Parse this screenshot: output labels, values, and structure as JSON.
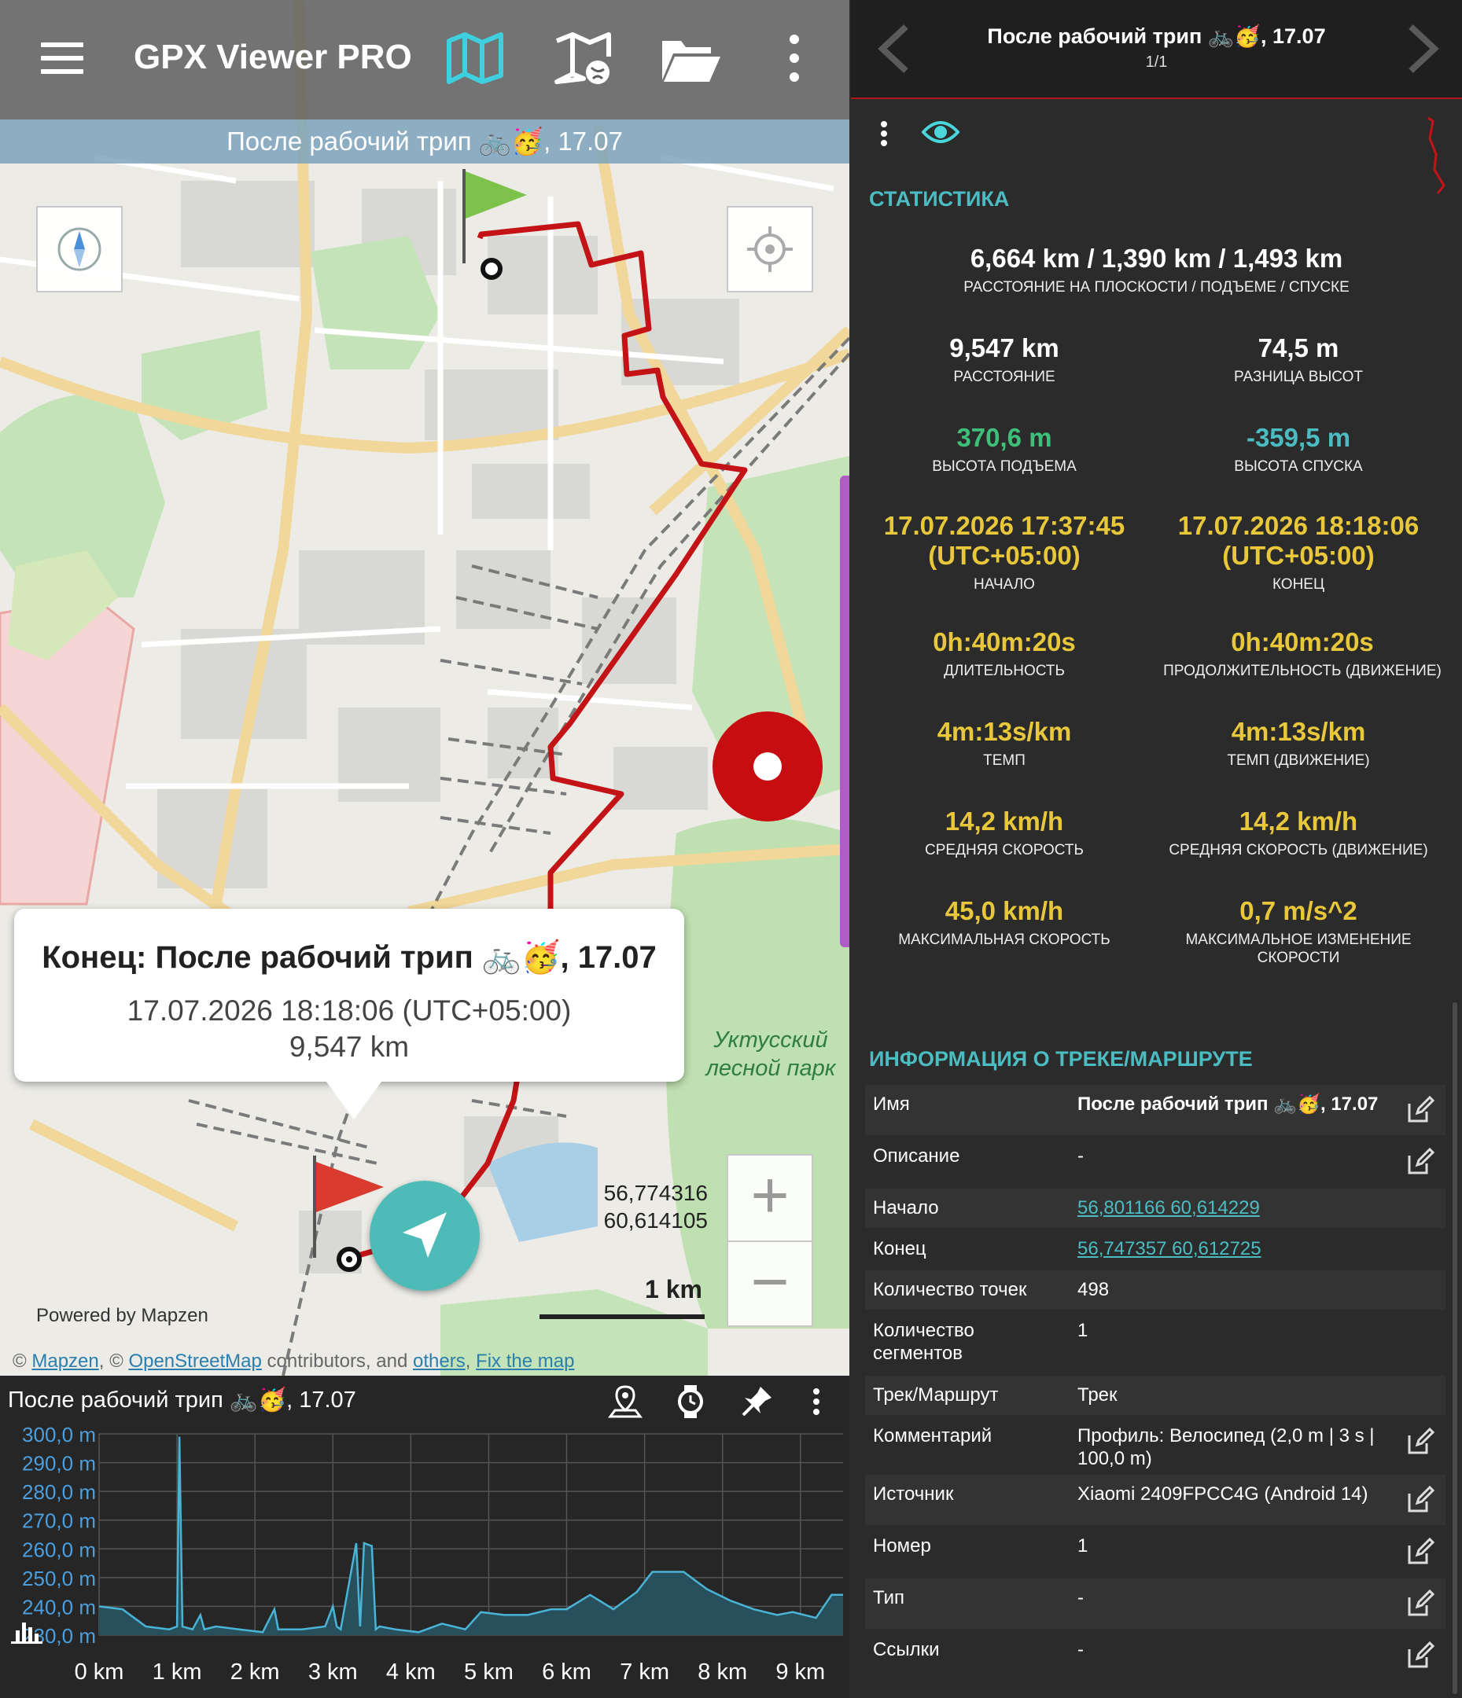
{
  "app": {
    "title": "GPX Viewer PRO",
    "track_banner": "После рабочий трип 🚲🥳, 17.07"
  },
  "map": {
    "popup": {
      "title": "Конец: После рабочий трип 🚲🥳, 17.07",
      "time": "17.07.2026 18:18:06 (UTC+05:00)",
      "distance": "9,547 km"
    },
    "coords": {
      "lat": "56,774316",
      "lon": "60,614105"
    },
    "scale_label": "1 km",
    "powered_by": "Powered by Mapzen",
    "attribution": {
      "prefix": "© ",
      "mapzen": "Mapzen",
      "mid": ", © ",
      "osm": "OpenStreetMap",
      "contrib": " contributors, and ",
      "others": "others",
      "sep": ", ",
      "fix": "Fix the map"
    },
    "park_label_1": "Уктусский",
    "park_label_2": "лесной парк",
    "zoom_in": "+",
    "zoom_out": "−",
    "colors": {
      "track": "#c41317",
      "accent": "#4dbcb8",
      "record": "#c50d12"
    }
  },
  "elevation": {
    "title": "После рабочий трип 🚲🥳, 17.07",
    "chart_data": {
      "type": "area",
      "ylim": [
        230,
        300
      ],
      "y_ticks": [
        "300,0 m",
        "290,0 m",
        "280,0 m",
        "270,0 m",
        "260,0 m",
        "250,0 m",
        "240,0 m",
        "230,0 m"
      ],
      "x_ticks": [
        "0 km",
        "1 km",
        "2 km",
        "3 km",
        "4 km",
        "5 km",
        "6 km",
        "7 km",
        "8 km",
        "9 km"
      ],
      "x": [
        0,
        0.3,
        0.6,
        0.9,
        1.0,
        1.03,
        1.07,
        1.2,
        1.3,
        1.35,
        1.5,
        1.8,
        2.1,
        2.25,
        2.3,
        2.6,
        2.9,
        3.0,
        3.05,
        3.1,
        3.3,
        3.35,
        3.4,
        3.5,
        3.55,
        3.6,
        3.8,
        4.1,
        4.4,
        4.7,
        4.9,
        5.2,
        5.5,
        5.8,
        6.0,
        6.3,
        6.6,
        6.9,
        7.1,
        7.5,
        7.8,
        8.1,
        8.4,
        8.7,
        8.9,
        9.2,
        9.4,
        9.547
      ],
      "y": [
        240,
        239,
        233,
        232,
        233,
        299,
        233,
        232,
        237,
        232,
        233,
        232,
        231,
        239,
        232,
        232,
        233,
        240,
        233,
        232,
        262,
        233,
        262,
        261,
        232,
        233,
        232,
        231,
        234,
        232,
        238,
        237,
        237,
        239,
        239,
        244,
        239,
        245,
        252,
        252,
        246,
        242,
        239,
        237,
        238,
        236,
        244,
        244
      ]
    },
    "bottom_icon": "bar-chart-icon"
  },
  "panel": {
    "title": "После рабочий трип 🚲🥳, 17.07",
    "page": "1/1",
    "stats_header": "СТАТИСТИКА",
    "stats": {
      "flat": {
        "value": "6,664 km / 1,390 km / 1,493 km",
        "label": "РАССТОЯНИЕ НА ПЛОСКОСТИ / ПОДЪЕМЕ / СПУСКЕ"
      },
      "distance": {
        "value": "9,547 km",
        "label": "РАССТОЯНИЕ"
      },
      "elev_diff": {
        "value": "74,5 m",
        "label": "РАЗНИЦА ВЫСОТ"
      },
      "ascent": {
        "value": "370,6 m",
        "label": "ВЫСОТА ПОДЪЕМА"
      },
      "descent": {
        "value": "-359,5 m",
        "label": "ВЫСОТА СПУСКА"
      },
      "start": {
        "value1": "17.07.2026 17:37:45",
        "value2": "(UTC+05:00)",
        "label": "НАЧАЛО"
      },
      "end": {
        "value1": "17.07.2026 18:18:06",
        "value2": "(UTC+05:00)",
        "label": "КОНЕЦ"
      },
      "duration": {
        "value": "0h:40m:20s",
        "label": "ДЛИТЕЛЬНОСТЬ"
      },
      "moving_duration": {
        "value": "0h:40m:20s",
        "label": "ПРОДОЛЖИТЕЛЬНОСТЬ (ДВИЖЕНИЕ)"
      },
      "pace": {
        "value": "4m:13s/km",
        "label": "ТЕМП"
      },
      "moving_pace": {
        "value": "4m:13s/km",
        "label": "ТЕМП (ДВИЖЕНИЕ)"
      },
      "avg_speed": {
        "value": "14,2 km/h",
        "label": "СРЕДНЯЯ СКОРОСТЬ"
      },
      "moving_speed": {
        "value": "14,2 km/h",
        "label": "СРЕДНЯЯ СКОРОСТЬ (ДВИЖЕНИЕ)"
      },
      "max_speed": {
        "value": "45,0 km/h",
        "label": "МАКСИМАЛЬНАЯ СКОРОСТЬ"
      },
      "max_accel": {
        "value": "0,7 m/s^2",
        "label1": "МАКСИМАЛЬНОЕ ИЗМЕНЕНИЕ",
        "label2": "СКОРОСТИ"
      }
    },
    "stat_colors": {
      "white": "#ffffff",
      "green": "#3fc07a",
      "teal": "#4bbdc2",
      "yellow": "#e8c83a"
    },
    "info_header": "ИНФОРМАЦИЯ О ТРЕКЕ/МАРШРУТЕ",
    "info": [
      {
        "key": "Имя",
        "value": "После рабочий трип 🚲🥳, 17.07"
      },
      {
        "key": "Описание",
        "value": "-"
      },
      {
        "key": "Начало",
        "value": "56,801166 60,614229"
      },
      {
        "key": "Конец",
        "value": "56,747357 60,612725"
      },
      {
        "key": "Количество точек",
        "value": "498"
      },
      {
        "key": "Количество сегментов",
        "value": "1"
      },
      {
        "key": "Трек/Маршрут",
        "value": "Трек"
      },
      {
        "key": "Комментарий",
        "value": "Профиль: Велосипед (2,0 m | 3 s | 100,0 m)"
      },
      {
        "key": "Источник",
        "value": "Xiaomi 2409FPCC4G (Android 14)"
      },
      {
        "key": "Номер",
        "value": "1"
      },
      {
        "key": "Тип",
        "value": "-"
      },
      {
        "key": "Ссылки",
        "value": "-"
      }
    ]
  }
}
